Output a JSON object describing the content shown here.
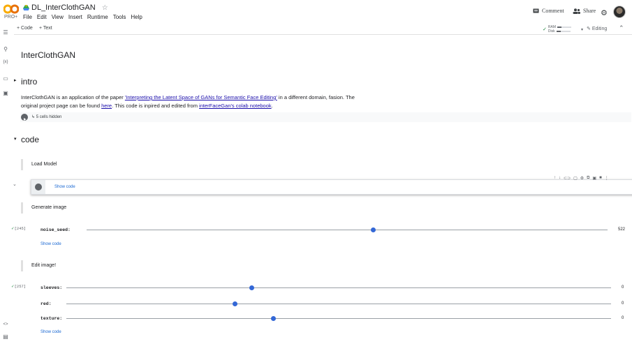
{
  "header": {
    "pro_label": "PRO+",
    "title": "DL_InterClothGAN",
    "menu": [
      "File",
      "Edit",
      "View",
      "Insert",
      "Runtime",
      "Tools",
      "Help"
    ],
    "comment_label": "Comment",
    "share_label": "Share"
  },
  "toolbar": {
    "code_label": "+ Code",
    "text_label": "+ Text",
    "ram_label": "RAM",
    "disk_label": "Disk",
    "editing_label": "Editing"
  },
  "notebook": {
    "title": "InterClothGAN",
    "intro_heading": "intro",
    "intro_text_1": "InterClothGAN is an application of the paper ",
    "intro_link_1": "'Interpreting the Latent Space of GANs for Semantic Face Editing'",
    "intro_text_2": " in a different domain, fasion. The",
    "intro_text_3": "original project page can be found ",
    "intro_link_2": "here",
    "intro_text_4": ". This code is inpired and edited from ",
    "intro_link_3": "interFaceGan's colab notebook",
    "intro_text_5": ".",
    "hidden_cells": "↳ 5 cells hidden",
    "code_heading": "code",
    "load_model": "Load Model",
    "show_code": "Show code",
    "generate_image": "Generate image",
    "gen_exec": "[245]",
    "noise_seed_label": "noise_seed:",
    "noise_seed_value": "522",
    "noise_seed_fraction": 0.55,
    "edit_image": "Edit image!",
    "edit_exec": "[257]",
    "sleeves_label": "sleeves:",
    "sleeves_value": "0",
    "sleeves_fraction": 0.34,
    "red_label": "red:",
    "red_value": "0",
    "red_fraction": 0.31,
    "texture_label": "texture:",
    "texture_value": "0",
    "texture_fraction": 0.38
  }
}
